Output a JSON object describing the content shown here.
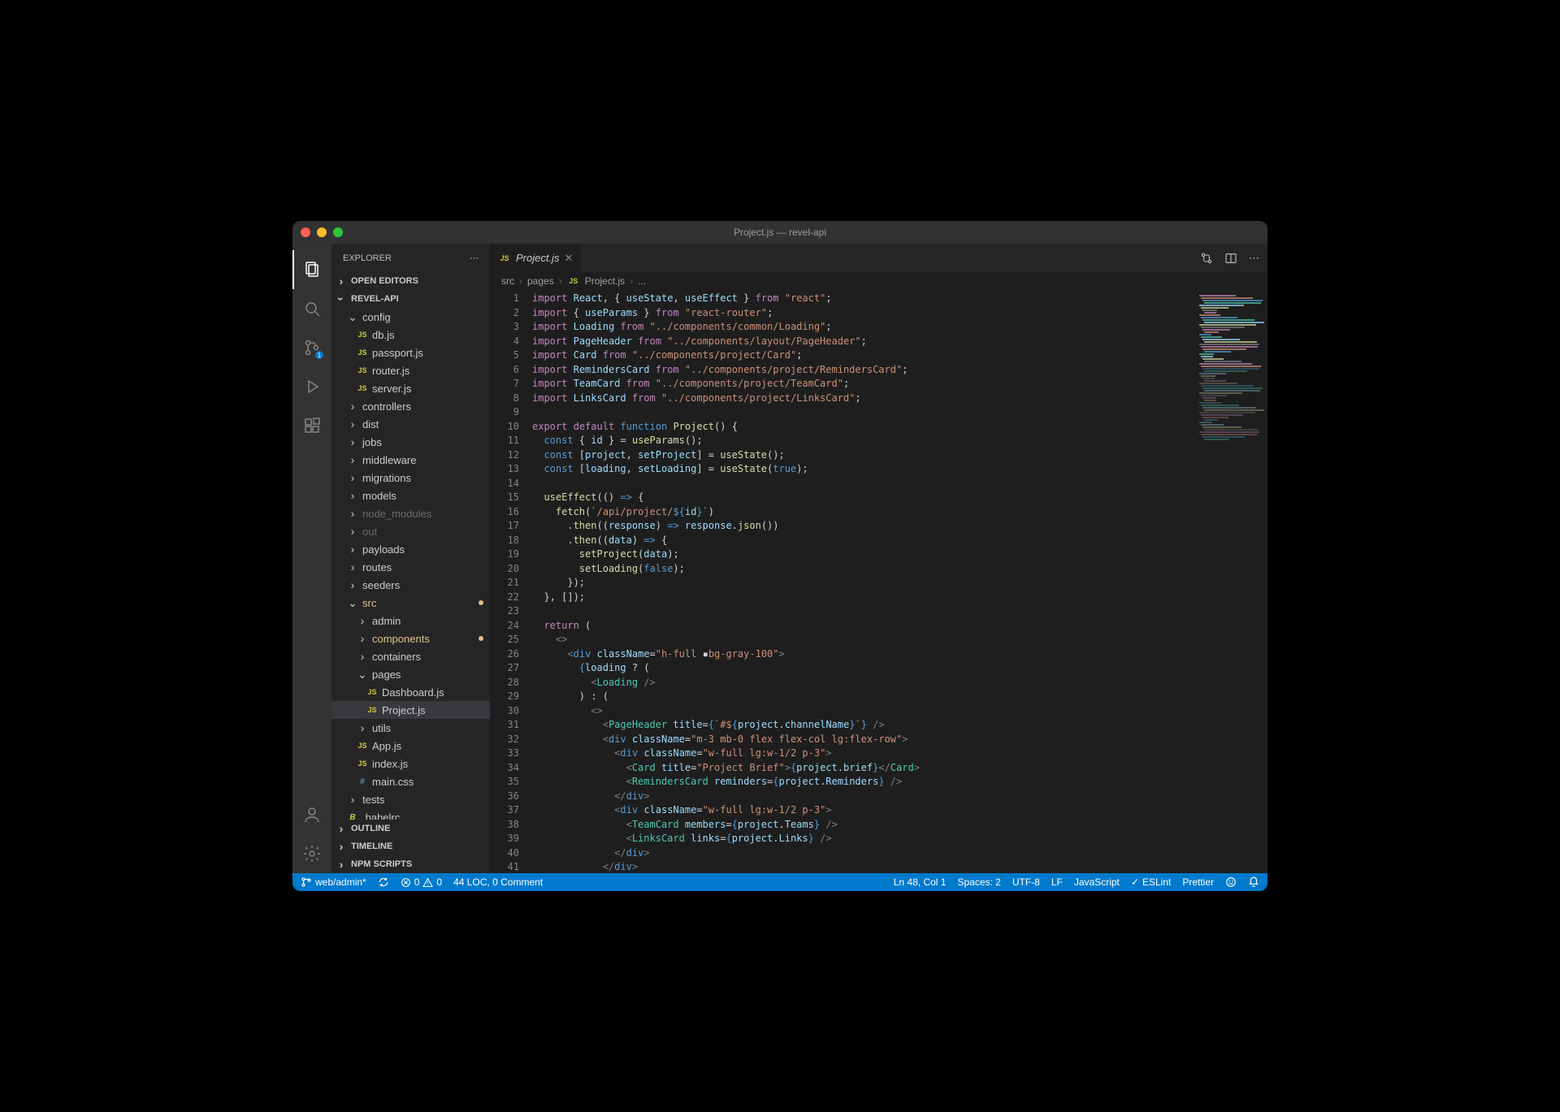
{
  "window": {
    "title": "Project.js — revel-api"
  },
  "sidebar": {
    "explorer_label": "EXPLORER",
    "panes": {
      "open_editors": "OPEN EDITORS",
      "workspace": "REVEL-API",
      "outline": "OUTLINE",
      "timeline": "TIMELINE",
      "npm": "NPM SCRIPTS"
    },
    "tree": [
      {
        "label": "config",
        "type": "folder",
        "depth": 1,
        "open": true
      },
      {
        "label": "db.js",
        "type": "js",
        "depth": 2
      },
      {
        "label": "passport.js",
        "type": "js",
        "depth": 2
      },
      {
        "label": "router.js",
        "type": "js",
        "depth": 2
      },
      {
        "label": "server.js",
        "type": "js",
        "depth": 2
      },
      {
        "label": "controllers",
        "type": "folder",
        "depth": 1
      },
      {
        "label": "dist",
        "type": "folder",
        "depth": 1
      },
      {
        "label": "jobs",
        "type": "folder",
        "depth": 1
      },
      {
        "label": "middleware",
        "type": "folder",
        "depth": 1
      },
      {
        "label": "migrations",
        "type": "folder",
        "depth": 1
      },
      {
        "label": "models",
        "type": "folder",
        "depth": 1
      },
      {
        "label": "node_modules",
        "type": "folder",
        "depth": 1,
        "dim": true
      },
      {
        "label": "out",
        "type": "folder",
        "depth": 1,
        "dim": true
      },
      {
        "label": "payloads",
        "type": "folder",
        "depth": 1
      },
      {
        "label": "routes",
        "type": "folder",
        "depth": 1
      },
      {
        "label": "seeders",
        "type": "folder",
        "depth": 1
      },
      {
        "label": "src",
        "type": "folder",
        "depth": 1,
        "open": true,
        "modified": true
      },
      {
        "label": "admin",
        "type": "folder",
        "depth": 2
      },
      {
        "label": "components",
        "type": "folder",
        "depth": 2,
        "modified": true
      },
      {
        "label": "containers",
        "type": "folder",
        "depth": 2
      },
      {
        "label": "pages",
        "type": "folder",
        "depth": 2,
        "open": true
      },
      {
        "label": "Dashboard.js",
        "type": "js",
        "depth": 3
      },
      {
        "label": "Project.js",
        "type": "js",
        "depth": 3,
        "selected": true
      },
      {
        "label": "utils",
        "type": "folder",
        "depth": 2
      },
      {
        "label": "App.js",
        "type": "js",
        "depth": 2
      },
      {
        "label": "index.js",
        "type": "js",
        "depth": 2
      },
      {
        "label": "main.css",
        "type": "css",
        "depth": 2
      },
      {
        "label": "tests",
        "type": "folder",
        "depth": 1
      },
      {
        "label": ".babelrc",
        "type": "babel",
        "depth": 1
      }
    ]
  },
  "tab": {
    "filename": "Project.js"
  },
  "breadcrumb": {
    "p1": "src",
    "p2": "pages",
    "p3": "Project.js",
    "p4": "..."
  },
  "status": {
    "branch": "web/admin*",
    "errors": "0",
    "warnings": "0",
    "loc": "44 LOC, 0 Comment",
    "cursor": "Ln 48, Col 1",
    "spaces": "Spaces: 2",
    "encoding": "UTF-8",
    "eol": "LF",
    "language": "JavaScript",
    "eslint": "ESLint",
    "prettier": "Prettier"
  },
  "colors": {
    "accent": "#007acc"
  },
  "code_lines": [
    "<span class='tok-kw'>import</span> <span class='tok-var'>React</span>, { <span class='tok-var'>useState</span>, <span class='tok-var'>useEffect</span> } <span class='tok-kw'>from</span> <span class='tok-str'>\"react\"</span>;",
    "<span class='tok-kw'>import</span> { <span class='tok-var'>useParams</span> } <span class='tok-kw'>from</span> <span class='tok-str'>\"react-router\"</span>;",
    "<span class='tok-kw'>import</span> <span class='tok-var'>Loading</span> <span class='tok-kw'>from</span> <span class='tok-str'>\"../components/common/Loading\"</span>;",
    "<span class='tok-kw'>import</span> <span class='tok-var'>PageHeader</span> <span class='tok-kw'>from</span> <span class='tok-str'>\"../components/layout/PageHeader\"</span>;",
    "<span class='tok-kw'>import</span> <span class='tok-var'>Card</span> <span class='tok-kw'>from</span> <span class='tok-str'>\"../components/project/Card\"</span>;",
    "<span class='tok-kw'>import</span> <span class='tok-var'>RemindersCard</span> <span class='tok-kw'>from</span> <span class='tok-str'>\"../components/project/RemindersCard\"</span>;",
    "<span class='tok-kw'>import</span> <span class='tok-var'>TeamCard</span> <span class='tok-kw'>from</span> <span class='tok-str'>\"../components/project/TeamCard\"</span>;",
    "<span class='tok-kw'>import</span> <span class='tok-var'>LinksCard</span> <span class='tok-kw'>from</span> <span class='tok-str'>\"../components/project/LinksCard\"</span>;",
    "",
    "<span class='tok-kw'>export</span> <span class='tok-kw'>default</span> <span class='tok-fn'>function</span> <span class='tok-call'>Project</span>() {",
    "  <span class='tok-fn'>const</span> { <span class='tok-var'>id</span> } = <span class='tok-call'>useParams</span>();",
    "  <span class='tok-fn'>const</span> [<span class='tok-var'>project</span>, <span class='tok-var'>setProject</span>] = <span class='tok-call'>useState</span>();",
    "  <span class='tok-fn'>const</span> [<span class='tok-var'>loading</span>, <span class='tok-var'>setLoading</span>] = <span class='tok-call'>useState</span>(<span class='tok-bool'>true</span>);",
    "",
    "  <span class='tok-call'>useEffect</span>(() <span class='tok-fn'>=&gt;</span> {",
    "    <span class='tok-call'>fetch</span>(<span class='tok-str'>`/api/project/</span><span class='tok-brace'>${</span><span class='tok-var'>id</span><span class='tok-brace'>}</span><span class='tok-str'>`</span>)",
    "      .<span class='tok-call'>then</span>((<span class='tok-var'>response</span>) <span class='tok-fn'>=&gt;</span> <span class='tok-var'>response</span>.<span class='tok-call'>json</span>())",
    "      .<span class='tok-call'>then</span>((<span class='tok-var'>data</span>) <span class='tok-fn'>=&gt;</span> {",
    "        <span class='tok-call'>setProject</span>(<span class='tok-var'>data</span>);",
    "        <span class='tok-call'>setLoading</span>(<span class='tok-bool'>false</span>);",
    "      });",
    "  }, []);",
    "",
    "  <span class='tok-kw'>return</span> (",
    "    <span class='tok-pn'>&lt;&gt;</span>",
    "      <span class='tok-pn'>&lt;</span><span class='tok-fn'>div</span> <span class='tok-attr'>className</span>=<span class='tok-str'>\"h-full <span style='color:#d4d4d4'>▪</span>bg-gray-100\"</span><span class='tok-pn'>&gt;</span>",
    "        <span class='tok-brace'>{</span><span class='tok-var'>loading</span> ? (",
    "          <span class='tok-pn'>&lt;</span><span class='tok-tag'>Loading</span> <span class='tok-pn'>/&gt;</span>",
    "        ) : (",
    "          <span class='tok-pn'>&lt;&gt;</span>",
    "            <span class='tok-pn'>&lt;</span><span class='tok-tag'>PageHeader</span> <span class='tok-attr'>title</span>=<span class='tok-brace'>{</span><span class='tok-str'>`#$</span><span class='tok-brace'>{</span><span class='tok-var'>project</span>.<span class='tok-var'>channelName</span><span class='tok-brace'>}</span><span class='tok-str'>`</span><span class='tok-brace'>}</span> <span class='tok-pn'>/&gt;</span>",
    "            <span class='tok-pn'>&lt;</span><span class='tok-fn'>div</span> <span class='tok-attr'>className</span>=<span class='tok-str'>\"m-3 mb-0 flex flex-col lg:flex-row\"</span><span class='tok-pn'>&gt;</span>",
    "              <span class='tok-pn'>&lt;</span><span class='tok-fn'>div</span> <span class='tok-attr'>className</span>=<span class='tok-str'>\"w-full lg:w-1/2 p-3\"</span><span class='tok-pn'>&gt;</span>",
    "                <span class='tok-pn'>&lt;</span><span class='tok-tag'>Card</span> <span class='tok-attr'>title</span>=<span class='tok-str'>\"Project Brief\"</span><span class='tok-pn'>&gt;</span><span class='tok-brace'>{</span><span class='tok-var'>project</span>.<span class='tok-var'>brief</span><span class='tok-brace'>}</span><span class='tok-pn'>&lt;/</span><span class='tok-tag'>Card</span><span class='tok-pn'>&gt;</span>",
    "                <span class='tok-pn'>&lt;</span><span class='tok-tag'>RemindersCard</span> <span class='tok-attr'>reminders</span>=<span class='tok-brace'>{</span><span class='tok-var'>project</span>.<span class='tok-var'>Reminders</span><span class='tok-brace'>}</span> <span class='tok-pn'>/&gt;</span>",
    "              <span class='tok-pn'>&lt;/</span><span class='tok-fn'>div</span><span class='tok-pn'>&gt;</span>",
    "              <span class='tok-pn'>&lt;</span><span class='tok-fn'>div</span> <span class='tok-attr'>className</span>=<span class='tok-str'>\"w-full lg:w-1/2 p-3\"</span><span class='tok-pn'>&gt;</span>",
    "                <span class='tok-pn'>&lt;</span><span class='tok-tag'>TeamCard</span> <span class='tok-attr'>members</span>=<span class='tok-brace'>{</span><span class='tok-var'>project</span>.<span class='tok-var'>Teams</span><span class='tok-brace'>}</span> <span class='tok-pn'>/&gt;</span>",
    "                <span class='tok-pn'>&lt;</span><span class='tok-tag'>LinksCard</span> <span class='tok-attr'>links</span>=<span class='tok-brace'>{</span><span class='tok-var'>project</span>.<span class='tok-var'>Links</span><span class='tok-brace'>}</span> <span class='tok-pn'>/&gt;</span>",
    "              <span class='tok-pn'>&lt;/</span><span class='tok-fn'>div</span><span class='tok-pn'>&gt;</span>",
    "            <span class='tok-pn'>&lt;/</span><span class='tok-fn'>div</span><span class='tok-pn'>&gt;</span>"
  ]
}
